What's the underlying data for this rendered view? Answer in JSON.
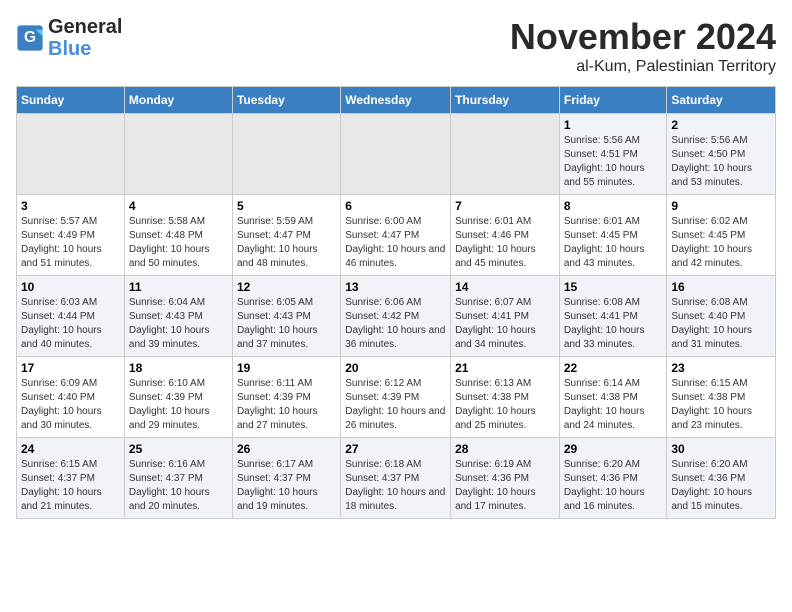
{
  "header": {
    "logo_line1": "General",
    "logo_line2": "Blue",
    "month": "November 2024",
    "location": "al-Kum, Palestinian Territory"
  },
  "weekdays": [
    "Sunday",
    "Monday",
    "Tuesday",
    "Wednesday",
    "Thursday",
    "Friday",
    "Saturday"
  ],
  "rows": [
    [
      {
        "day": "",
        "empty": true
      },
      {
        "day": "",
        "empty": true
      },
      {
        "day": "",
        "empty": true
      },
      {
        "day": "",
        "empty": true
      },
      {
        "day": "",
        "empty": true
      },
      {
        "day": "1",
        "sunrise": "5:56 AM",
        "sunset": "4:51 PM",
        "daylight": "10 hours and 55 minutes."
      },
      {
        "day": "2",
        "sunrise": "5:56 AM",
        "sunset": "4:50 PM",
        "daylight": "10 hours and 53 minutes."
      }
    ],
    [
      {
        "day": "3",
        "sunrise": "5:57 AM",
        "sunset": "4:49 PM",
        "daylight": "10 hours and 51 minutes."
      },
      {
        "day": "4",
        "sunrise": "5:58 AM",
        "sunset": "4:48 PM",
        "daylight": "10 hours and 50 minutes."
      },
      {
        "day": "5",
        "sunrise": "5:59 AM",
        "sunset": "4:47 PM",
        "daylight": "10 hours and 48 minutes."
      },
      {
        "day": "6",
        "sunrise": "6:00 AM",
        "sunset": "4:47 PM",
        "daylight": "10 hours and 46 minutes."
      },
      {
        "day": "7",
        "sunrise": "6:01 AM",
        "sunset": "4:46 PM",
        "daylight": "10 hours and 45 minutes."
      },
      {
        "day": "8",
        "sunrise": "6:01 AM",
        "sunset": "4:45 PM",
        "daylight": "10 hours and 43 minutes."
      },
      {
        "day": "9",
        "sunrise": "6:02 AM",
        "sunset": "4:45 PM",
        "daylight": "10 hours and 42 minutes."
      }
    ],
    [
      {
        "day": "10",
        "sunrise": "6:03 AM",
        "sunset": "4:44 PM",
        "daylight": "10 hours and 40 minutes."
      },
      {
        "day": "11",
        "sunrise": "6:04 AM",
        "sunset": "4:43 PM",
        "daylight": "10 hours and 39 minutes."
      },
      {
        "day": "12",
        "sunrise": "6:05 AM",
        "sunset": "4:43 PM",
        "daylight": "10 hours and 37 minutes."
      },
      {
        "day": "13",
        "sunrise": "6:06 AM",
        "sunset": "4:42 PM",
        "daylight": "10 hours and 36 minutes."
      },
      {
        "day": "14",
        "sunrise": "6:07 AM",
        "sunset": "4:41 PM",
        "daylight": "10 hours and 34 minutes."
      },
      {
        "day": "15",
        "sunrise": "6:08 AM",
        "sunset": "4:41 PM",
        "daylight": "10 hours and 33 minutes."
      },
      {
        "day": "16",
        "sunrise": "6:08 AM",
        "sunset": "4:40 PM",
        "daylight": "10 hours and 31 minutes."
      }
    ],
    [
      {
        "day": "17",
        "sunrise": "6:09 AM",
        "sunset": "4:40 PM",
        "daylight": "10 hours and 30 minutes."
      },
      {
        "day": "18",
        "sunrise": "6:10 AM",
        "sunset": "4:39 PM",
        "daylight": "10 hours and 29 minutes."
      },
      {
        "day": "19",
        "sunrise": "6:11 AM",
        "sunset": "4:39 PM",
        "daylight": "10 hours and 27 minutes."
      },
      {
        "day": "20",
        "sunrise": "6:12 AM",
        "sunset": "4:39 PM",
        "daylight": "10 hours and 26 minutes."
      },
      {
        "day": "21",
        "sunrise": "6:13 AM",
        "sunset": "4:38 PM",
        "daylight": "10 hours and 25 minutes."
      },
      {
        "day": "22",
        "sunrise": "6:14 AM",
        "sunset": "4:38 PM",
        "daylight": "10 hours and 24 minutes."
      },
      {
        "day": "23",
        "sunrise": "6:15 AM",
        "sunset": "4:38 PM",
        "daylight": "10 hours and 23 minutes."
      }
    ],
    [
      {
        "day": "24",
        "sunrise": "6:15 AM",
        "sunset": "4:37 PM",
        "daylight": "10 hours and 21 minutes."
      },
      {
        "day": "25",
        "sunrise": "6:16 AM",
        "sunset": "4:37 PM",
        "daylight": "10 hours and 20 minutes."
      },
      {
        "day": "26",
        "sunrise": "6:17 AM",
        "sunset": "4:37 PM",
        "daylight": "10 hours and 19 minutes."
      },
      {
        "day": "27",
        "sunrise": "6:18 AM",
        "sunset": "4:37 PM",
        "daylight": "10 hours and 18 minutes."
      },
      {
        "day": "28",
        "sunrise": "6:19 AM",
        "sunset": "4:36 PM",
        "daylight": "10 hours and 17 minutes."
      },
      {
        "day": "29",
        "sunrise": "6:20 AM",
        "sunset": "4:36 PM",
        "daylight": "10 hours and 16 minutes."
      },
      {
        "day": "30",
        "sunrise": "6:20 AM",
        "sunset": "4:36 PM",
        "daylight": "10 hours and 15 minutes."
      }
    ]
  ]
}
